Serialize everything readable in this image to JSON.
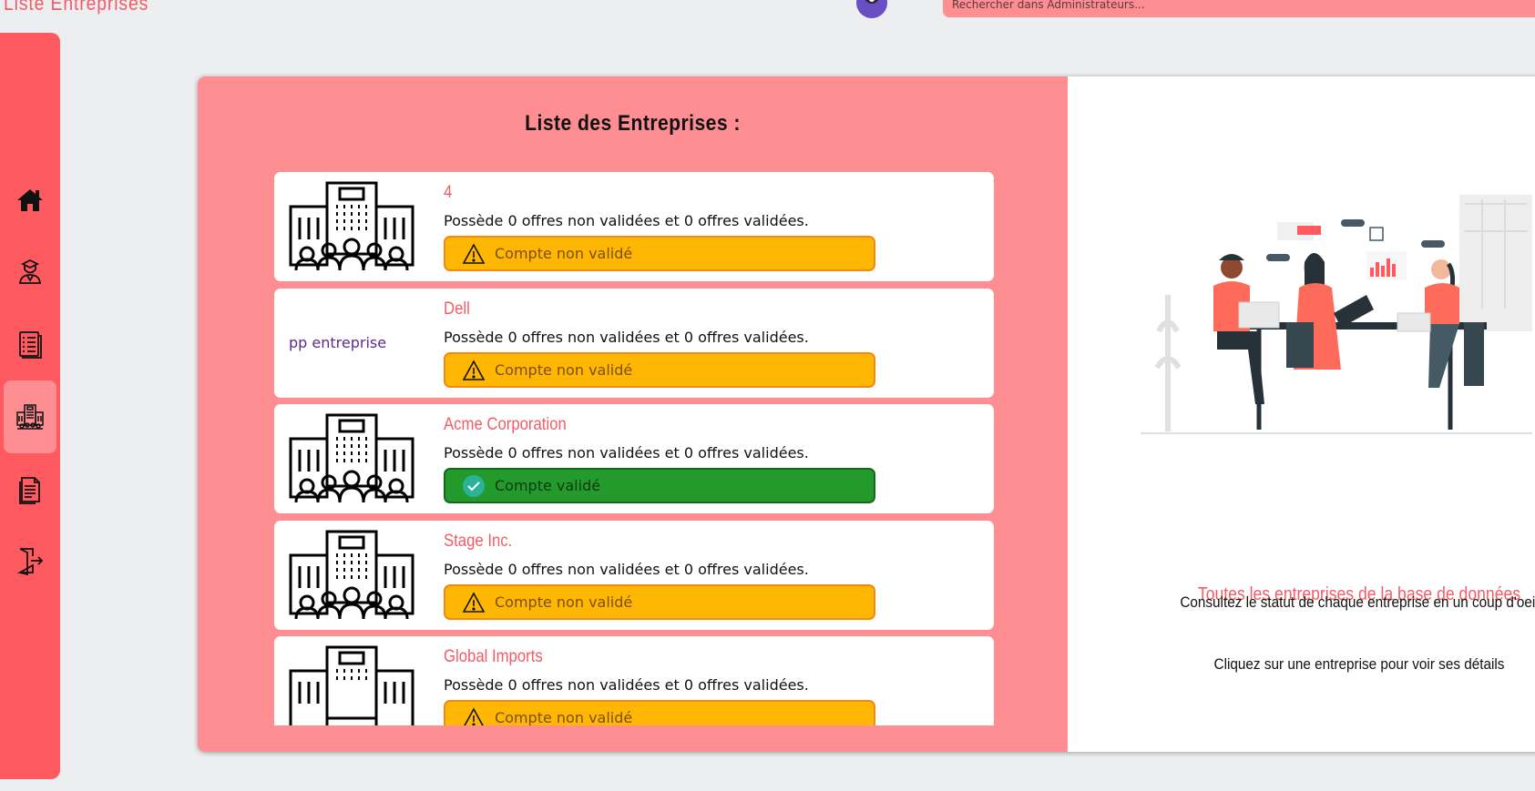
{
  "header": {
    "title": "Liste Entreprises",
    "search_placeholder": "Rechercher dans Administrateurs..."
  },
  "sidebar": {
    "items": [
      {
        "icon": "home-icon",
        "active": false
      },
      {
        "icon": "student-icon",
        "active": false
      },
      {
        "icon": "offers-list-icon",
        "active": false
      },
      {
        "icon": "companies-icon",
        "active": true
      },
      {
        "icon": "documents-icon",
        "active": false
      },
      {
        "icon": "logout-icon",
        "active": false
      }
    ]
  },
  "list": {
    "title": "Liste des Entreprises :",
    "companies": [
      {
        "name": "4",
        "logo": "building-icon",
        "description": "Possède 0 offres non validées et 0 offres validées.",
        "status": "Compte non validé",
        "validated": false
      },
      {
        "name": "Dell",
        "logo_text": "pp entreprise",
        "description": "Possède 0 offres non validées et 0 offres validées.",
        "status": "Compte non validé",
        "validated": false
      },
      {
        "name": "Acme Corporation",
        "logo": "building-icon",
        "description": "Possède 0 offres non validées et 0 offres validées.",
        "status": "Compte validé",
        "validated": true
      },
      {
        "name": "Stage Inc.",
        "logo": "building-icon",
        "description": "Possède 0 offres non validées et 0 offres validées.",
        "status": "Compte non validé",
        "validated": false
      },
      {
        "name": "Global Imports",
        "logo": "building-icon",
        "description": "Possède 0 offres non validées et 0 offres validées.",
        "status": "Compte non validé",
        "validated": false
      }
    ]
  },
  "info": {
    "title": "Toutes les entreprises de la base de données",
    "line1": "Consultez le statut de chaque entreprise en un coup d'oeil",
    "line2": "Cliquez sur une entreprise pour voir ses détails"
  },
  "colors": {
    "accent": "#f25c66",
    "sidebar": "#ff5a60",
    "panel": "#ff8e92",
    "warning": "#ffb703",
    "success": "#239a2b"
  }
}
